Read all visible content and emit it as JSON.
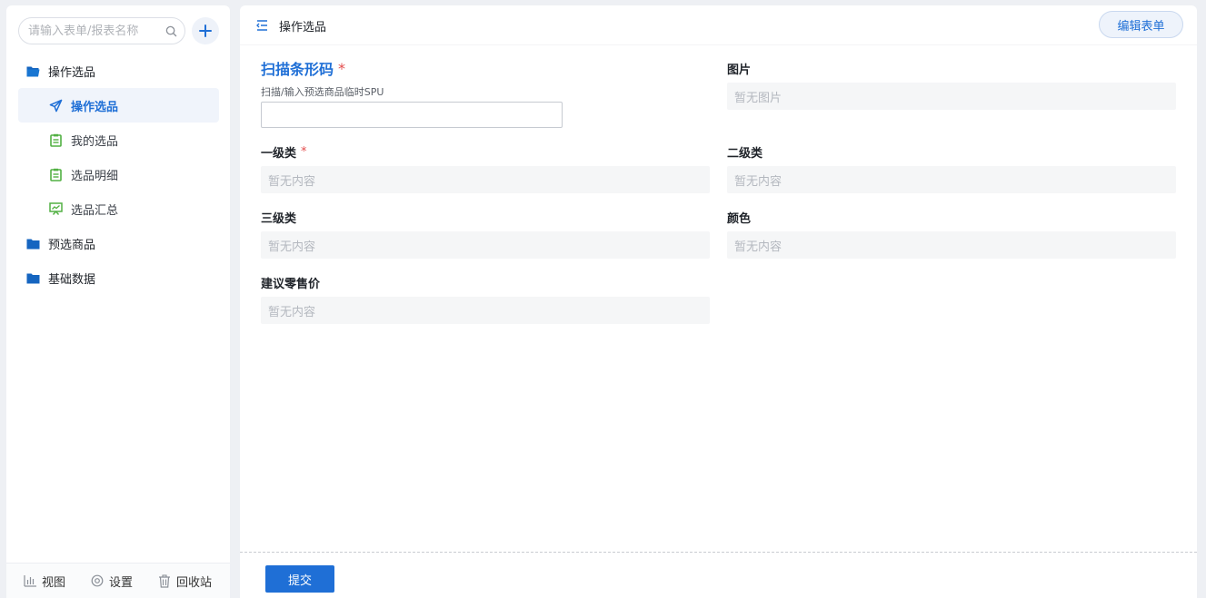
{
  "sidebar": {
    "search_placeholder": "请输入表单/报表名称",
    "nav": [
      {
        "label": "操作选品",
        "type": "group",
        "icon": "folder-open-icon"
      },
      {
        "label": "操作选品",
        "type": "child",
        "icon": "send-icon",
        "active": true
      },
      {
        "label": "我的选品",
        "type": "child",
        "icon": "clipboard-icon"
      },
      {
        "label": "选品明细",
        "type": "child",
        "icon": "clipboard-icon"
      },
      {
        "label": "选品汇总",
        "type": "child",
        "icon": "chart-board-icon"
      },
      {
        "label": "预选商品",
        "type": "group",
        "icon": "folder-icon"
      },
      {
        "label": "基础数据",
        "type": "group",
        "icon": "folder-icon"
      }
    ],
    "footer": {
      "view_label": "视图",
      "settings_label": "设置",
      "trash_label": "回收站"
    }
  },
  "header": {
    "title": "操作选品",
    "edit_button": "编辑表单"
  },
  "form": {
    "barcode": {
      "label": "扫描条形码",
      "required": "*",
      "hint": "扫描/输入预选商品临时SPU",
      "value": ""
    },
    "image": {
      "label": "图片",
      "placeholder": "暂无图片"
    },
    "category1": {
      "label": "一级类",
      "required": "*",
      "placeholder": "暂无内容"
    },
    "category2": {
      "label": "二级类",
      "placeholder": "暂无内容"
    },
    "category3": {
      "label": "三级类",
      "placeholder": "暂无内容"
    },
    "color": {
      "label": "颜色",
      "placeholder": "暂无内容"
    },
    "retail_price": {
      "label": "建议零售价",
      "placeholder": "暂无内容"
    },
    "submit_label": "提交"
  },
  "colors": {
    "accent": "#1f6fd6",
    "folder": "#1565c0",
    "green_icon": "#52b043",
    "required": "#e34d4d"
  }
}
